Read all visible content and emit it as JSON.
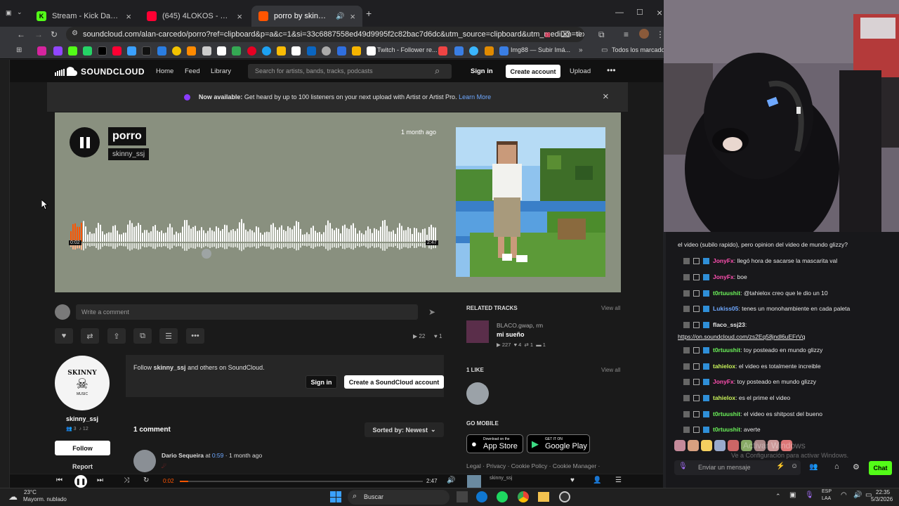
{
  "browser": {
    "tabs": [
      {
        "title": "Stream - Kick Dashboard"
      },
      {
        "title": "(645) 4LOKOS - TUSSIWARRIOR"
      },
      {
        "title": "porro by skinny_ssj"
      }
    ],
    "url": "soundcloud.com/alan-carcedo/porro?ref=clipboard&p=a&c=1&si=33c6887558ed49d9995f2c82bac7d6dc&utm_source=clipboard&utm_medium=text&ut",
    "bookmarks": [
      "Twitch - Follower re...",
      "Img88 — Subir Imá...",
      "Todos los marcadores"
    ]
  },
  "soundcloud": {
    "logo": "SOUNDCLOUD",
    "nav": [
      "Home",
      "Feed",
      "Library"
    ],
    "search_placeholder": "Search for artists, bands, tracks, podcasts",
    "sign_in": "Sign in",
    "create_account": "Create account",
    "upload": "Upload",
    "banner_strong": "Now available:",
    "banner_text": "Get heard by up to 100 listeners on your next upload with Artist or Artist Pro.",
    "banner_link": "Learn More",
    "track": {
      "title": "porro",
      "artist": "skinny_ssj",
      "posted": "1 month ago",
      "current_time": "0:02",
      "duration": "2:47",
      "progress": 0.012
    },
    "comment_placeholder": "Write a comment",
    "plays": "22",
    "likes": "1",
    "related": {
      "heading": "RELATED TRACKS",
      "view_all": "View all",
      "artist": "BLACO.gwap, rm",
      "title": "mi sueño",
      "plays": "227",
      "likes": "4",
      "reposts": "1",
      "comments": "1"
    },
    "likes_section": {
      "heading": "1 LIKE",
      "view_all": "View all"
    },
    "mobile": {
      "heading": "GO MOBILE",
      "app_store": "App Store",
      "app_store_small": "Download on the",
      "google_play": "Google Play",
      "google_play_small": "GET IT ON"
    },
    "footer": "Legal · Privacy · Cookie Policy · Cookie Manager ·",
    "artist_card": {
      "name": "skinny_ssj",
      "followers": "3",
      "tracks": "12",
      "follow": "Follow",
      "report": "Report",
      "logo_text": "SKINNY",
      "logo_sub": "MUSIC"
    },
    "follow_prompt": {
      "prefix": "Follow",
      "name": "skinny_ssj",
      "suffix": "and others on SoundCloud.",
      "sign_in": "Sign in",
      "create": "Create a SoundCloud account"
    },
    "comments": {
      "count_label": "1 comment",
      "sort_label": "Sorted by: Newest",
      "author": "Dario Sequeira",
      "at": "at",
      "time": "0:59",
      "ago": "· 1 month ago"
    },
    "player": {
      "current": "0:02",
      "total": "2:47",
      "artist": "skinny_ssj"
    }
  },
  "chat": {
    "messages": [
      {
        "user": "",
        "text": "el video (subilo rapido), pero opinion del video de mundo glizzy?",
        "color": "#e8e8e8"
      },
      {
        "user": "JonyFx",
        "text": ": llegó hora de sacarse la mascarita val",
        "color": "#ff4fb0"
      },
      {
        "user": "JonyFx",
        "text": ": boe",
        "color": "#ff4fb0"
      },
      {
        "user": "t0rtuushit",
        "text": ": @tahielox creo que le dio un 10",
        "color": "#6cf25a"
      },
      {
        "user": "Lukiss05",
        "text": ": tenes un monohambiente en cada paleta",
        "color": "#6fa8ff"
      },
      {
        "user": "flaco_ssj23",
        "text": ":",
        "color": "#e8e8e8"
      },
      {
        "user": "",
        "text": "https://on.soundcloud.com/zs2Eq58jndl6uEFrVq",
        "color": "#e8e8e8"
      },
      {
        "user": "t0rtuushit",
        "text": ": toy posteado en mundo glizzy",
        "color": "#6cf25a"
      },
      {
        "user": "tahielox",
        "text": ": el video es totalmente increible",
        "color": "#c9f25a"
      },
      {
        "user": "JonyFx",
        "text": ": toy posteado en mundo glizzy",
        "color": "#ff4fb0"
      },
      {
        "user": "tahielox",
        "text": ": es el prime el video",
        "color": "#c9f25a"
      },
      {
        "user": "t0rtuushit",
        "text": ": el video es shitpost del bueno",
        "color": "#6cf25a"
      },
      {
        "user": "t0rtuushit",
        "text": ": averte",
        "color": "#6cf25a"
      }
    ],
    "activate_windows": "Ve a Configuración para activar Windows.",
    "activate_title": "Activar Windows",
    "input_placeholder": "Enviar un mensaje",
    "chat_button": "Chat"
  },
  "taskbar": {
    "temp": "23°C",
    "weather": "Mayorm. nublado",
    "search": "Buscar",
    "lang1": "ESP",
    "lang2": "LAA",
    "time": "22:35",
    "date": "5/3/2026"
  }
}
